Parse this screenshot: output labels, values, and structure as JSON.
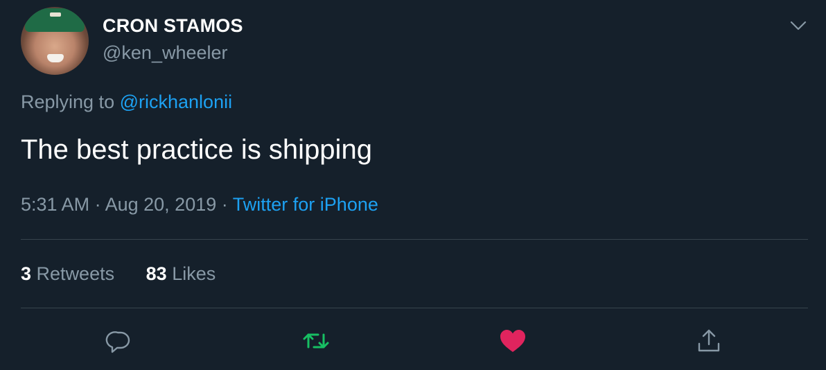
{
  "author": {
    "display_name": "CRON STAMOS",
    "handle": "@ken_wheeler",
    "avatar_icon": "user-avatar-photo"
  },
  "reply": {
    "prefix": "Replying to",
    "mention": "@rickhanlonii"
  },
  "tweet": {
    "text": "The best practice is shipping"
  },
  "meta": {
    "time": "5:31 AM",
    "separator_1": "·",
    "date": "Aug 20, 2019",
    "separator_2": "·",
    "source": "Twitter for iPhone"
  },
  "stats": {
    "retweets_count": "3",
    "retweets_label": "Retweets",
    "likes_count": "83",
    "likes_label": "Likes"
  },
  "actions": [
    {
      "name": "reply",
      "icon": "reply-bubble-icon"
    },
    {
      "name": "retweet",
      "icon": "retweet-icon",
      "active": true
    },
    {
      "name": "like",
      "icon": "heart-icon",
      "active": true
    },
    {
      "name": "share",
      "icon": "share-icon"
    }
  ],
  "colors": {
    "background": "#15202b",
    "text_primary": "#ffffff",
    "text_secondary": "#8899a6",
    "link": "#1da1f2",
    "divider": "#38444d",
    "retweet_active": "#17bf63",
    "like_active": "#e0245e"
  }
}
